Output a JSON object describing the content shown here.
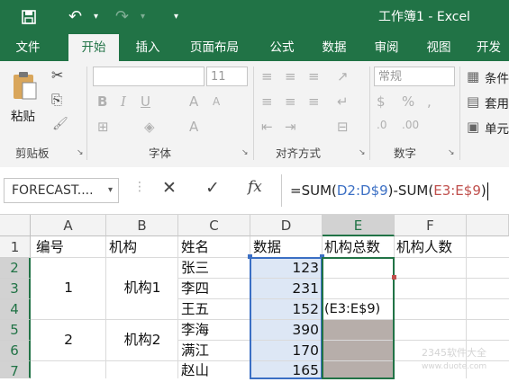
{
  "window": {
    "title": "工作簿1 - Excel"
  },
  "ribbon_tabs": [
    "文件",
    "开始",
    "插入",
    "页面布局",
    "公式",
    "数据",
    "审阅",
    "视图",
    "开发"
  ],
  "ribbon": {
    "clipboard": {
      "paste_label": "粘贴",
      "group_label": "剪贴板"
    },
    "font": {
      "group_label": "字体",
      "size_value": "11"
    },
    "alignment": {
      "group_label": "对齐方式"
    },
    "number": {
      "group_label": "数字",
      "format_value": "常规"
    },
    "styles": {
      "items": [
        "条件",
        "套用",
        "单元"
      ]
    }
  },
  "formula_bar": {
    "name_box": "FORECAST....",
    "formula_parts": [
      "=SUM(",
      "D2:D$9",
      ")-SUM(",
      "E3:E$9",
      ")"
    ]
  },
  "sheet": {
    "columns": [
      "A",
      "B",
      "C",
      "D",
      "E",
      "F"
    ],
    "rows": [
      "1",
      "2",
      "3",
      "4",
      "5",
      "6",
      "7"
    ],
    "headers": [
      "编号",
      "机构",
      "姓名",
      "数据",
      "机构总数",
      "机构人数"
    ],
    "groups": [
      {
        "id": "1",
        "org": "机构1"
      },
      {
        "id": "2",
        "org": "机构2"
      }
    ],
    "names": [
      "张三",
      "李四",
      "王五",
      "李海",
      "满江",
      "赵山"
    ],
    "values": [
      "123",
      "231",
      "152",
      "390",
      "170",
      "165"
    ],
    "edit_cell": "(E3:E$9)"
  },
  "colors": {
    "excel_green": "#217346",
    "range_blue": "#3b6fc4",
    "range_red": "#c0504d"
  }
}
